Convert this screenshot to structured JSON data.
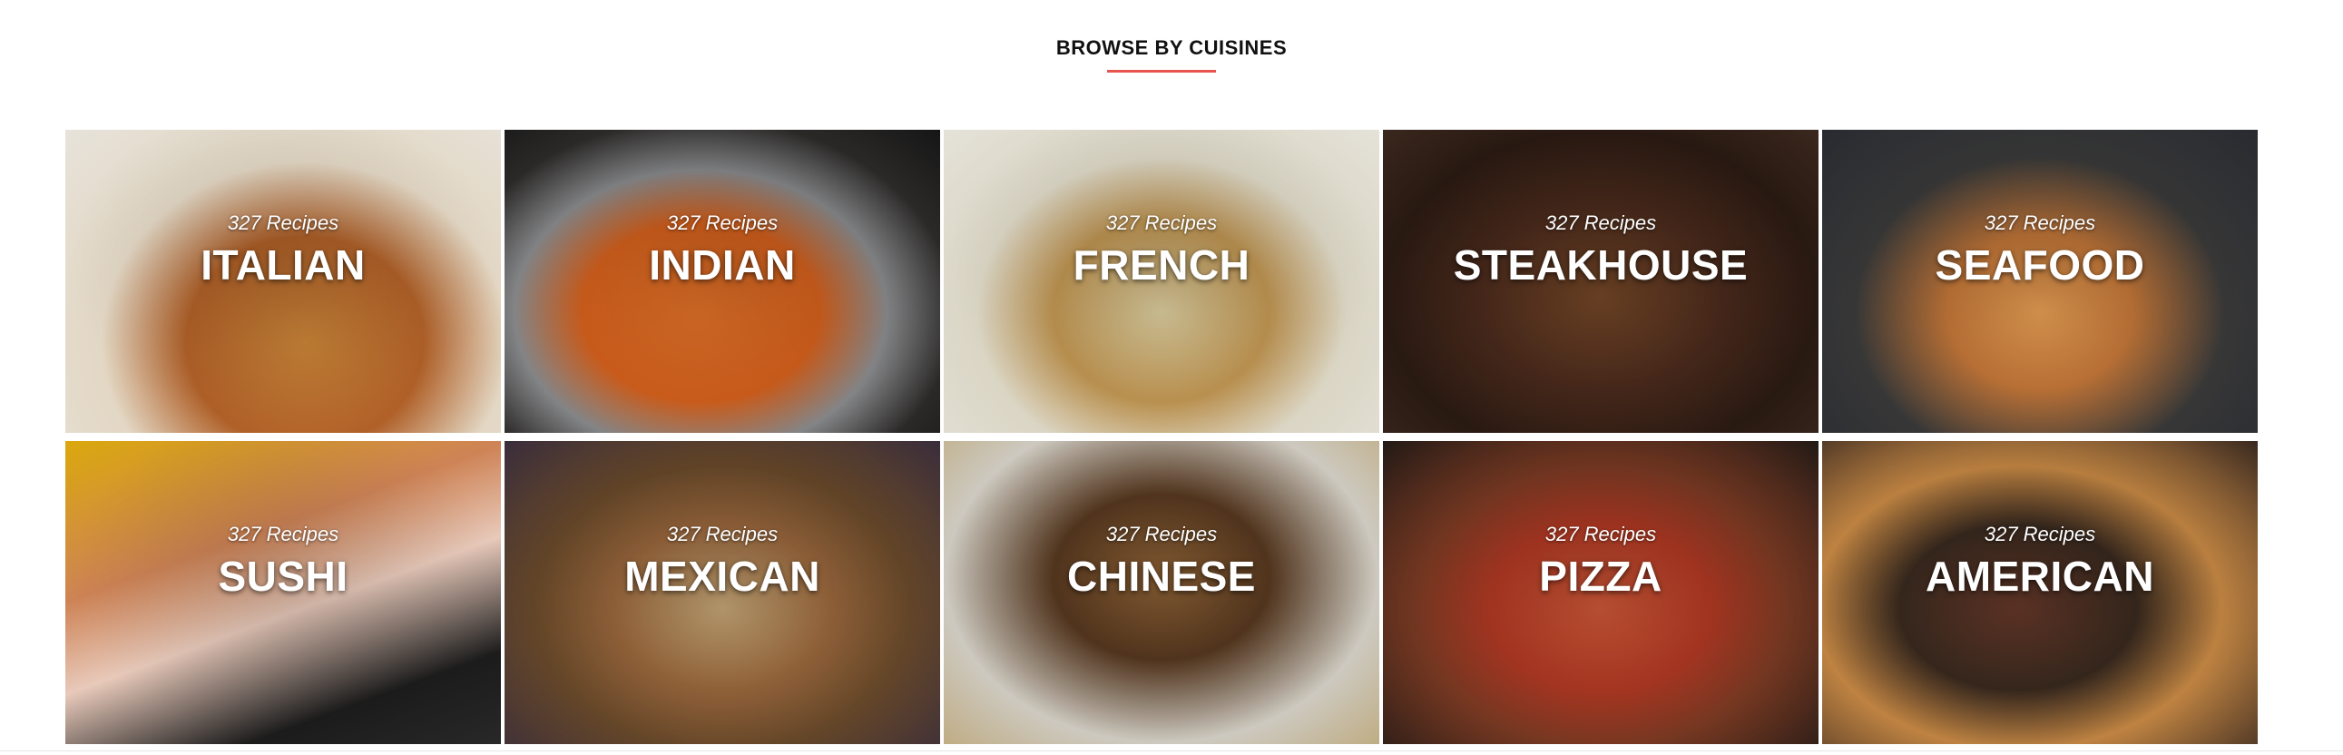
{
  "section": {
    "title": "BROWSE BY CUISINES"
  },
  "cuisines": [
    {
      "count": "327 Recipes",
      "name": "ITALIAN"
    },
    {
      "count": "327 Recipes",
      "name": "INDIAN"
    },
    {
      "count": "327 Recipes",
      "name": "FRENCH"
    },
    {
      "count": "327 Recipes",
      "name": "STEAKHOUSE"
    },
    {
      "count": "327 Recipes",
      "name": "SEAFOOD"
    },
    {
      "count": "327 Recipes",
      "name": "SUSHI"
    },
    {
      "count": "327 Recipes",
      "name": "MEXICAN"
    },
    {
      "count": "327 Recipes",
      "name": "CHINESE"
    },
    {
      "count": "327 Recipes",
      "name": "PIZZA"
    },
    {
      "count": "327 Recipes",
      "name": "AMERICAN"
    }
  ],
  "colors": {
    "accent": "#e8554e",
    "title_text": "#111111",
    "tile_text": "#ffffff"
  }
}
